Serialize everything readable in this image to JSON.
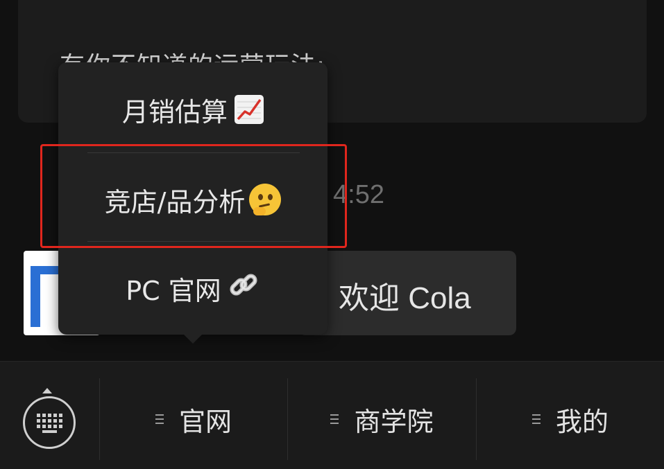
{
  "chat": {
    "top_message_text": "有你不知道的运营玩法:",
    "timestamp": "4:52",
    "welcome_message": "欢迎 Cola"
  },
  "popup_menu": {
    "items": [
      {
        "label": "月销估算",
        "icon": "chart-increasing-emoji"
      },
      {
        "label": "竞店/品分析",
        "icon": "thinking-face-emoji"
      },
      {
        "label": "PC 官网",
        "icon": "link-emoji"
      }
    ],
    "highlighted_index": 1,
    "highlight_color": "#e0261d"
  },
  "bottom_bar": {
    "keyboard_toggle_icon": "keyboard-icon",
    "tabs": [
      {
        "label": "官网",
        "icon": "menu-lines-icon"
      },
      {
        "label": "商学院",
        "icon": "menu-lines-icon"
      },
      {
        "label": "我的",
        "icon": "menu-lines-icon"
      }
    ]
  },
  "colors": {
    "background": "#111111",
    "popup_background": "#222222",
    "bubble_background": "#2c2c2c",
    "avatar_logo_blue": "#2a6fd4"
  }
}
